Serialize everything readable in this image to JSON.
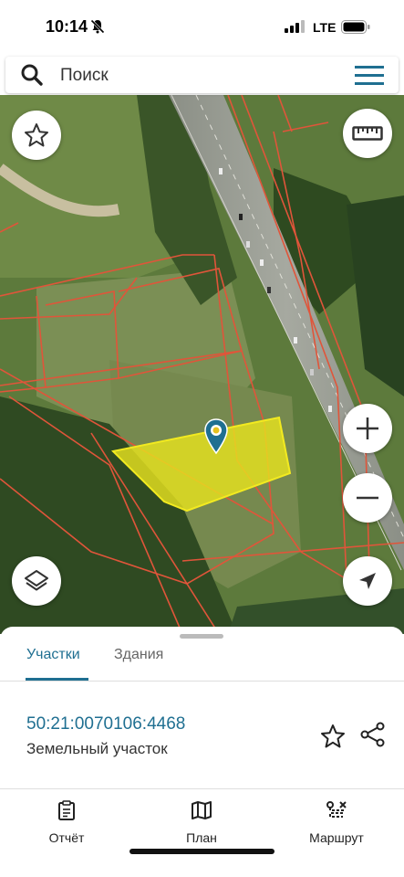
{
  "status_bar": {
    "time": "10:14",
    "network": "LTE"
  },
  "search": {
    "placeholder": "Поиск"
  },
  "map": {
    "buttons": [
      "favorites",
      "ruler",
      "zoom-in",
      "zoom-out",
      "layers",
      "my-location"
    ],
    "selected_parcel_color": "#e6e21f",
    "boundary_color": "#e0553a"
  },
  "sheet": {
    "tabs": [
      {
        "label": "Участки",
        "active": true
      },
      {
        "label": "Здания",
        "active": false
      }
    ],
    "parcel": {
      "number": "50:21:0070106:4468",
      "type": "Земельный участок"
    }
  },
  "bottom_nav": [
    {
      "label": "Отчёт",
      "icon": "report-icon"
    },
    {
      "label": "План",
      "icon": "map-icon"
    },
    {
      "label": "Маршрут",
      "icon": "route-icon"
    }
  ],
  "colors": {
    "accent": "#1f6f91"
  }
}
